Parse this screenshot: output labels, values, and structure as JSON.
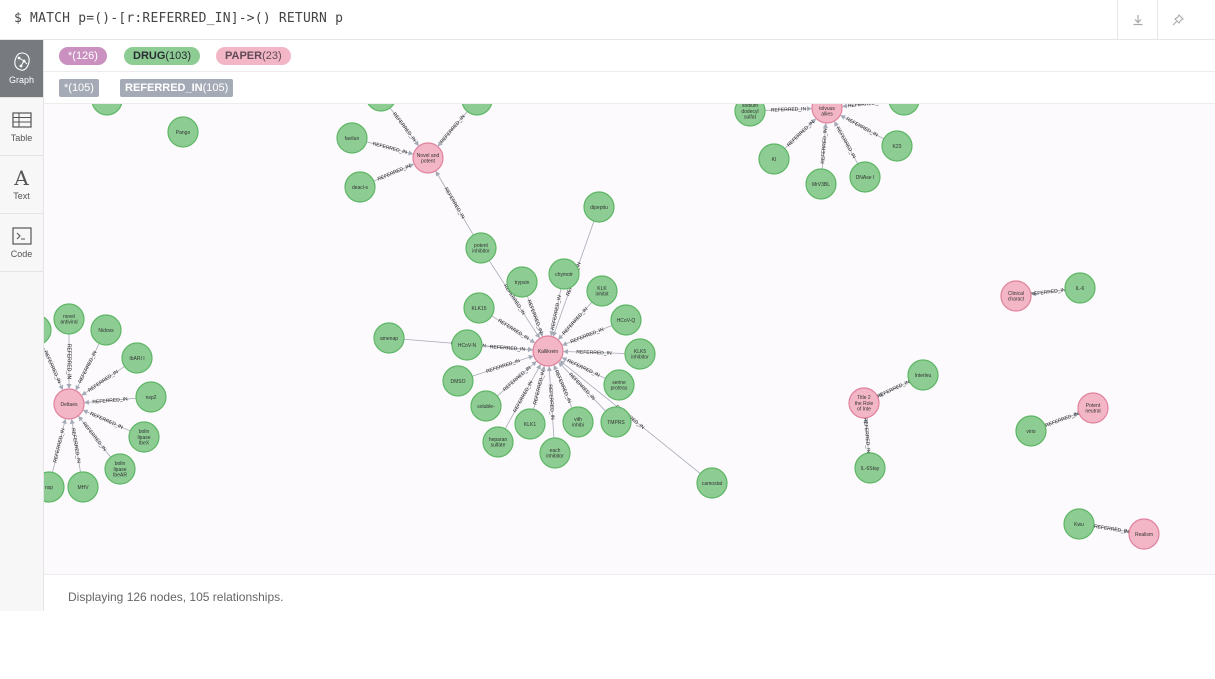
{
  "query": {
    "text": "$ MATCH p=()-[r:REFERRED_IN]->() RETURN p",
    "download_icon": "download-icon",
    "pin_icon": "pin-icon"
  },
  "sidebar": {
    "items": [
      {
        "label": "Graph",
        "icon": "graph-icon",
        "active": true
      },
      {
        "label": "Table",
        "icon": "table-icon",
        "active": false
      },
      {
        "label": "Text",
        "icon": "text-icon",
        "active": false
      },
      {
        "label": "Code",
        "icon": "code-icon",
        "active": false
      }
    ]
  },
  "legend": {
    "node_labels": [
      {
        "name": "*",
        "count": "(126)",
        "color": "#c990c0",
        "text_color": "#ffffff"
      },
      {
        "name": "DRUG",
        "count": "(103)",
        "color": "#8dcc93",
        "text_color": "#2a2c34"
      },
      {
        "name": "PAPER",
        "count": "(23)",
        "color": "#f2b6c6",
        "text_color": "#604a55"
      }
    ],
    "rel_types": [
      {
        "name": "*",
        "count": "(105)"
      },
      {
        "name": "REFERRED_IN",
        "count": "(105)"
      }
    ]
  },
  "graph": {
    "colors": {
      "drug_fill": "#8dcc93",
      "drug_stroke": "#5db665",
      "paper_fill": "#f2b6c6",
      "paper_stroke": "#e0819d",
      "edge": "#a5abb6"
    },
    "rel_label": "REFERRED_IN",
    "nodes": [
      {
        "id": "d_pango",
        "label": "Pango",
        "type": "drug"
      },
      {
        "id": "d_partial_tl",
        "label": "",
        "type": "drug"
      },
      {
        "id": "d_partial_nov1",
        "label": "",
        "type": "drug"
      },
      {
        "id": "d_partial_nov2",
        "label": "",
        "type": "drug"
      },
      {
        "id": "p_novel",
        "label": "Novel and potent",
        "type": "paper"
      },
      {
        "id": "d_favilun",
        "label": "favilun",
        "type": "drug"
      },
      {
        "id": "d_deacl",
        "label": "deacl-s",
        "type": "drug"
      },
      {
        "id": "d_sodium",
        "label": "sodium dodecyl sulfat",
        "type": "drug"
      },
      {
        "id": "p_tr",
        "label": "novel tolvuus allies",
        "type": "paper"
      },
      {
        "id": "d_partial_tr",
        "label": "",
        "type": "drug"
      },
      {
        "id": "d_ki",
        "label": "KI",
        "type": "drug"
      },
      {
        "id": "d_k23",
        "label": "K23",
        "type": "drug"
      },
      {
        "id": "d_mv3bl",
        "label": "MrV3BL",
        "type": "drug"
      },
      {
        "id": "d_dnase",
        "label": "DNAse I",
        "type": "drug"
      },
      {
        "id": "d_dipeptiu",
        "label": "dipeptiu",
        "type": "drug"
      },
      {
        "id": "d_potent_inh",
        "label": "potent inhibitor",
        "type": "drug"
      },
      {
        "id": "p_kallikrein",
        "label": "Kallikrein",
        "type": "paper"
      },
      {
        "id": "d_trypsin",
        "label": "trypsin",
        "type": "drug"
      },
      {
        "id": "d_chymotr",
        "label": "chymotr",
        "type": "drug"
      },
      {
        "id": "d_klk_inh",
        "label": "KLK inhibit",
        "type": "drug"
      },
      {
        "id": "d_klk15",
        "label": "KLK15",
        "type": "drug"
      },
      {
        "id": "d_hcovq",
        "label": "HCoV-Q",
        "type": "drug"
      },
      {
        "id": "d_amenap",
        "label": "amenap",
        "type": "drug"
      },
      {
        "id": "d_hcovn",
        "label": "HCoV-N",
        "type": "drug"
      },
      {
        "id": "d_klk5_inh",
        "label": "KLK5 inhibitor",
        "type": "drug"
      },
      {
        "id": "d_dmso",
        "label": "DMSO",
        "type": "drug"
      },
      {
        "id": "d_serine",
        "label": "serine proteas",
        "type": "drug"
      },
      {
        "id": "d_soluble",
        "label": "soluble-",
        "type": "drug"
      },
      {
        "id": "d_klk1",
        "label": "KLK1",
        "type": "drug"
      },
      {
        "id": "d_vith",
        "label": "vith inhibi",
        "type": "drug"
      },
      {
        "id": "d_tmprss",
        "label": "TMPRS",
        "type": "drug"
      },
      {
        "id": "d_heparan",
        "label": "heparan sulfate",
        "type": "drug"
      },
      {
        "id": "d_each",
        "label": "each inhibitor",
        "type": "drug"
      },
      {
        "id": "d_camostat",
        "label": "camostat",
        "type": "drug"
      },
      {
        "id": "p_clinical",
        "label": "Clinical charact",
        "type": "paper"
      },
      {
        "id": "d_il6",
        "label": "IL-6",
        "type": "drug"
      },
      {
        "id": "p_role",
        "label": "Title 2 the Role of Inte",
        "type": "paper"
      },
      {
        "id": "d_interleu",
        "label": "Interleu",
        "type": "drug"
      },
      {
        "id": "d_il6stay",
        "label": "IL-6Stay",
        "type": "drug"
      },
      {
        "id": "p_potent",
        "label": "Potent neutral",
        "type": "paper"
      },
      {
        "id": "d_virio",
        "label": "virio",
        "type": "drug"
      },
      {
        "id": "p_realism",
        "label": "Realism",
        "type": "paper"
      },
      {
        "id": "d_kwu",
        "label": "Kwu",
        "type": "drug"
      },
      {
        "id": "p_deltasm",
        "label": "Deltaes",
        "type": "paper"
      },
      {
        "id": "d_novel_antiviral",
        "label": "novel antiviral",
        "type": "drug"
      },
      {
        "id": "d_nidovs",
        "label": "Nidovs",
        "type": "drug"
      },
      {
        "id": "d_icarii",
        "label": "IbARI I",
        "type": "drug"
      },
      {
        "id": "d_nsp2",
        "label": "nsp2",
        "type": "drug"
      },
      {
        "id": "d_bolin_x",
        "label": "bolin lipase IbeX",
        "type": "drug"
      },
      {
        "id": "d_bolin_ar",
        "label": "bolin lipase IbeAR",
        "type": "drug"
      },
      {
        "id": "d_mhv",
        "label": "MHV",
        "type": "drug"
      },
      {
        "id": "d_nsp",
        "label": "nsp",
        "type": "drug"
      },
      {
        "id": "d_partial_l",
        "label": "",
        "type": "drug"
      }
    ]
  },
  "footer": {
    "status": "Displaying 126 nodes, 105 relationships."
  }
}
